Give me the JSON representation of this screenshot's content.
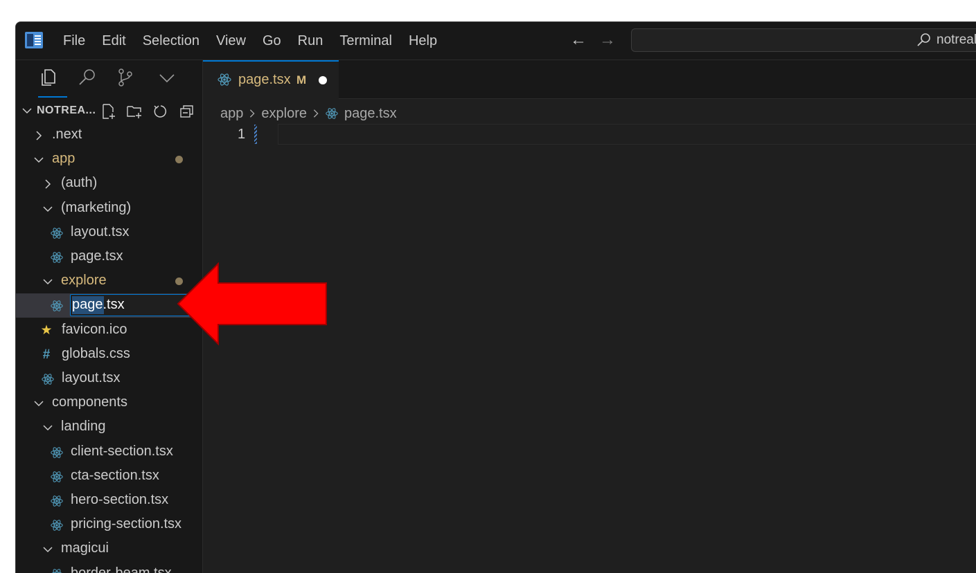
{
  "menu": [
    "File",
    "Edit",
    "Selection",
    "View",
    "Go",
    "Run",
    "Terminal",
    "Help"
  ],
  "command_center": {
    "text": "notreal"
  },
  "explorer": {
    "title": "NOTREA..."
  },
  "tree": [
    {
      "label": ".next",
      "depth": 0,
      "kind": "folder",
      "expanded": false,
      "modified": false
    },
    {
      "label": "app",
      "depth": 0,
      "kind": "folder",
      "expanded": true,
      "modified": true
    },
    {
      "label": "(auth)",
      "depth": 1,
      "kind": "folder",
      "expanded": false,
      "modified": false
    },
    {
      "label": "(marketing)",
      "depth": 1,
      "kind": "folder",
      "expanded": true,
      "modified": false
    },
    {
      "label": "layout.tsx",
      "depth": 2,
      "kind": "react",
      "modified": false
    },
    {
      "label": "page.tsx",
      "depth": 2,
      "kind": "react",
      "modified": false
    },
    {
      "label": "explore",
      "depth": 1,
      "kind": "folder",
      "expanded": true,
      "modified": true
    },
    {
      "label": "page.tsx",
      "depth": 2,
      "kind": "react-rename",
      "modified": false
    },
    {
      "label": "favicon.ico",
      "depth": 1,
      "kind": "star",
      "modified": false
    },
    {
      "label": "globals.css",
      "depth": 1,
      "kind": "hash",
      "modified": false
    },
    {
      "label": "layout.tsx",
      "depth": 1,
      "kind": "react",
      "modified": false
    },
    {
      "label": "components",
      "depth": 0,
      "kind": "folder",
      "expanded": true,
      "modified": false
    },
    {
      "label": "landing",
      "depth": 1,
      "kind": "folder",
      "expanded": true,
      "modified": false
    },
    {
      "label": "client-section.tsx",
      "depth": 2,
      "kind": "react",
      "modified": false
    },
    {
      "label": "cta-section.tsx",
      "depth": 2,
      "kind": "react",
      "modified": false
    },
    {
      "label": "hero-section.tsx",
      "depth": 2,
      "kind": "react",
      "modified": false
    },
    {
      "label": "pricing-section.tsx",
      "depth": 2,
      "kind": "react",
      "modified": false
    },
    {
      "label": "magicui",
      "depth": 1,
      "kind": "folder",
      "expanded": true,
      "modified": false
    },
    {
      "label": "border-beam.tsx",
      "depth": 2,
      "kind": "react",
      "modified": false
    }
  ],
  "rename": {
    "selected": "page",
    "rest": ".tsx"
  },
  "tab": {
    "label": "page.tsx",
    "status": "M"
  },
  "breadcrumb": [
    "app",
    "explore",
    "page.tsx"
  ],
  "editor": {
    "line_number": "1"
  },
  "colors": {
    "accent": "#0078d4",
    "modified": "#d7ba7d",
    "react": "#519aba",
    "annotation_arrow": "#ff0000"
  }
}
